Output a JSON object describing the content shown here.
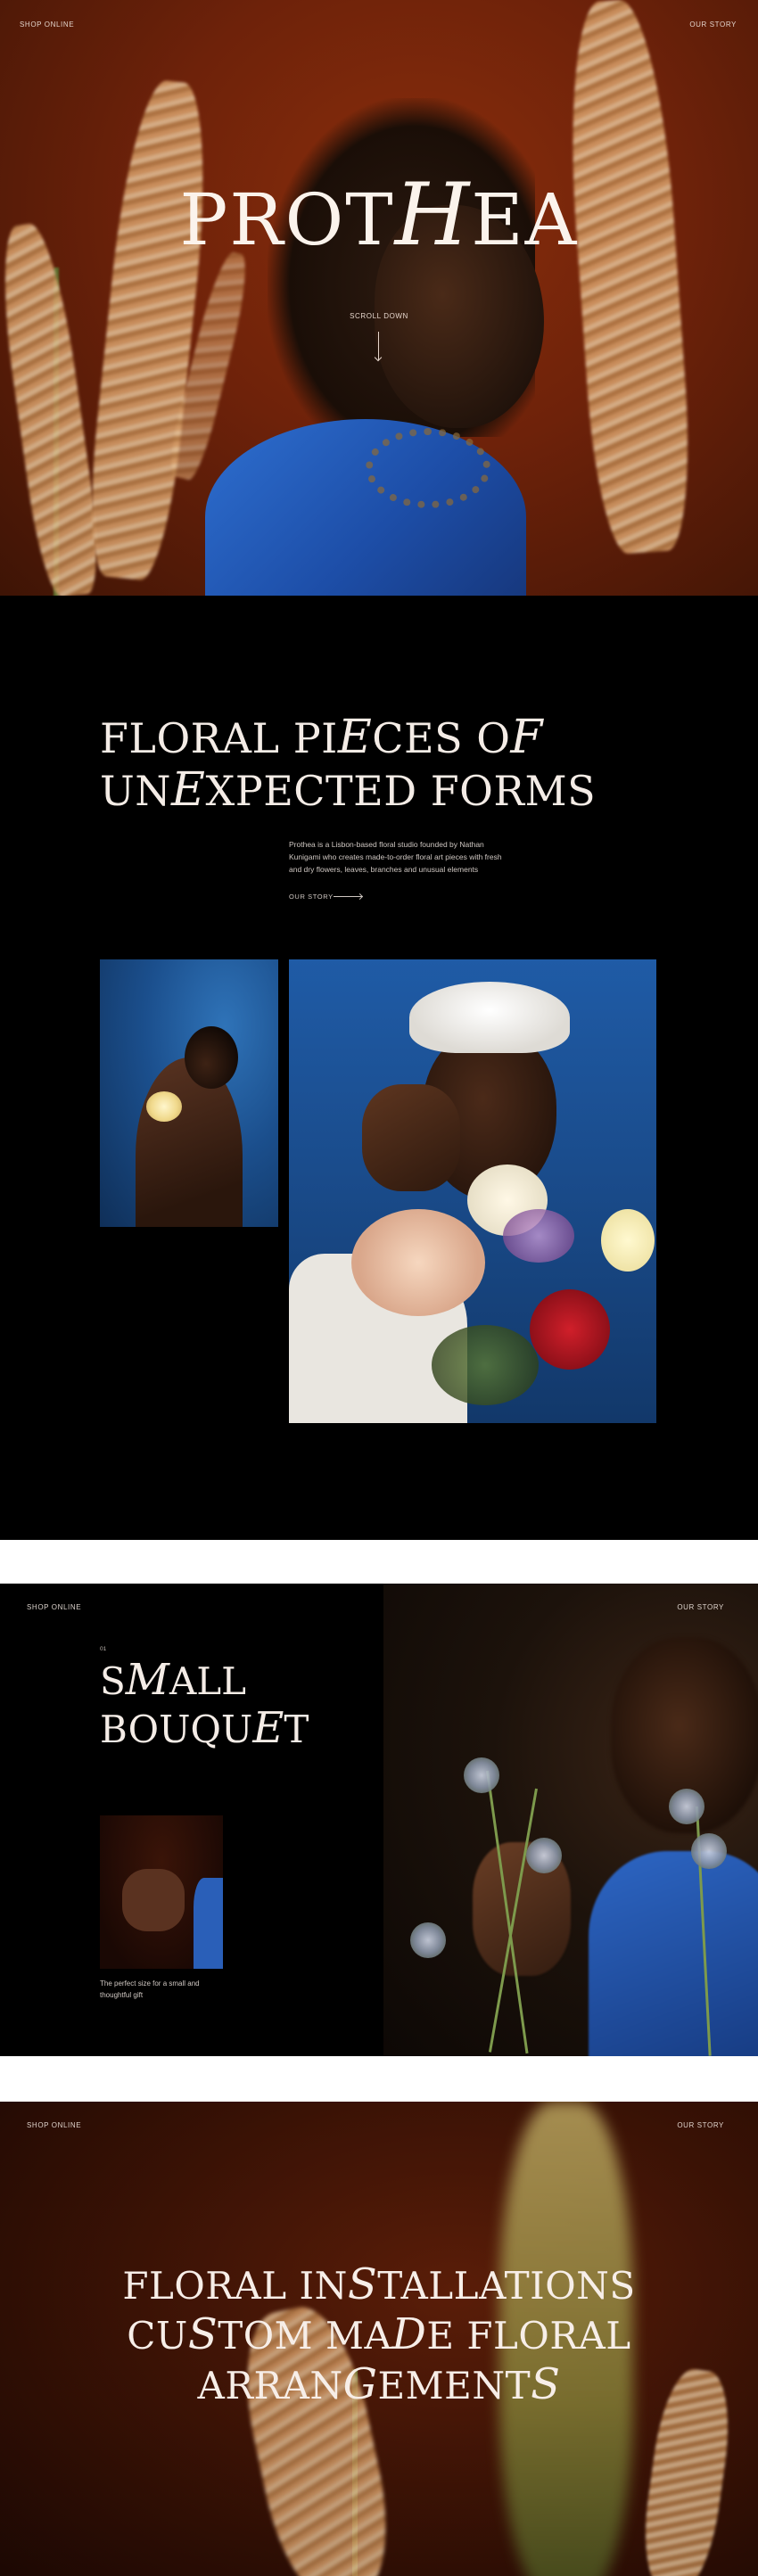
{
  "hero": {
    "nav_left": "SHOP ONLINE",
    "nav_right": "OUR STORY",
    "title_before": "PROT",
    "title_script": "H",
    "title_after": "EA",
    "scroll_label": "SCROLL DOWN"
  },
  "intro": {
    "heading_line1_a": "FLORAL PI",
    "heading_line1_script": "E",
    "heading_line1_b": "CES O",
    "heading_line1_script2": "F",
    "heading_line2_a": "UN",
    "heading_line2_script": "E",
    "heading_line2_b": "XPECTED FORMS",
    "description": "Prothea is a Lisbon-based floral studio founded by Nathan Kunigami who creates made-to-order floral art pieces with fresh and dry flowers, leaves, branches and unusual elements",
    "story_link": "OUR STORY"
  },
  "bouquet": {
    "nav_left": "SHOP ONLINE",
    "nav_right": "OUR STORY",
    "number": "01",
    "title_line1_a": "S",
    "title_line1_script": "M",
    "title_line1_b": "ALL",
    "title_line2_a": "BOUQU",
    "title_line2_script": "E",
    "title_line2_b": "T",
    "caption": "The perfect size for a small and thoughtful gift"
  },
  "installations": {
    "nav_left": "SHOP ONLINE",
    "nav_right": "OUR STORY",
    "line1_a": "FLORAL IN",
    "line1_script": "S",
    "line1_b": "TALLATIONS",
    "line2_a": "CU",
    "line2_script": "S",
    "line2_b": "TOM MA",
    "line2_script2": "D",
    "line2_c": "E FLORAL",
    "line3_a": "ARRAN",
    "line3_script": "G",
    "line3_b": "EMENT",
    "line3_script2": "S"
  },
  "colors": {
    "hero_bg": "#6e220a",
    "accent_blue": "#1d4ea8",
    "text_light": "#f4ece6"
  }
}
